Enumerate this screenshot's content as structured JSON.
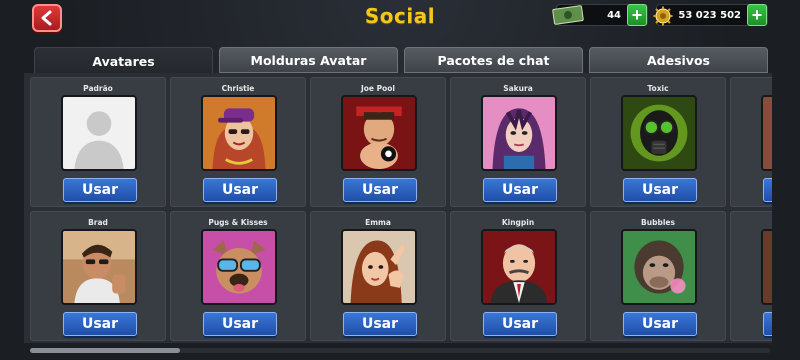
{
  "header": {
    "title": "Social",
    "back_icon": "chevron-left-icon",
    "cash": {
      "value": "44",
      "icon": "cash-icon"
    },
    "coins": {
      "value": "53 023 502",
      "icon": "coin-icon"
    },
    "plus_label": "+"
  },
  "tabs": [
    {
      "label": "Avatares",
      "active": true
    },
    {
      "label": "Molduras Avatar",
      "active": false
    },
    {
      "label": "Pacotes de chat",
      "active": false
    },
    {
      "label": "Adesivos",
      "active": false
    }
  ],
  "avatars": [
    {
      "name": "Padrão",
      "button": "Usar"
    },
    {
      "name": "Christie",
      "button": "Usar"
    },
    {
      "name": "Joe Pool",
      "button": "Usar"
    },
    {
      "name": "Sakura",
      "button": "Usar"
    },
    {
      "name": "Toxic",
      "button": "Usar"
    },
    {
      "name": "",
      "button": ""
    },
    {
      "name": "Brad",
      "button": "Usar"
    },
    {
      "name": "Pugs & Kisses",
      "button": "Usar"
    },
    {
      "name": "Emma",
      "button": "Usar"
    },
    {
      "name": "Kingpin",
      "button": "Usar"
    },
    {
      "name": "Bubbles",
      "button": "Usar"
    },
    {
      "name": "",
      "button": ""
    }
  ],
  "colors": {
    "title": "#f3c81a",
    "use_button": "#2a62c4",
    "plus_button": "#2aa838",
    "back_button": "#c9292b"
  }
}
